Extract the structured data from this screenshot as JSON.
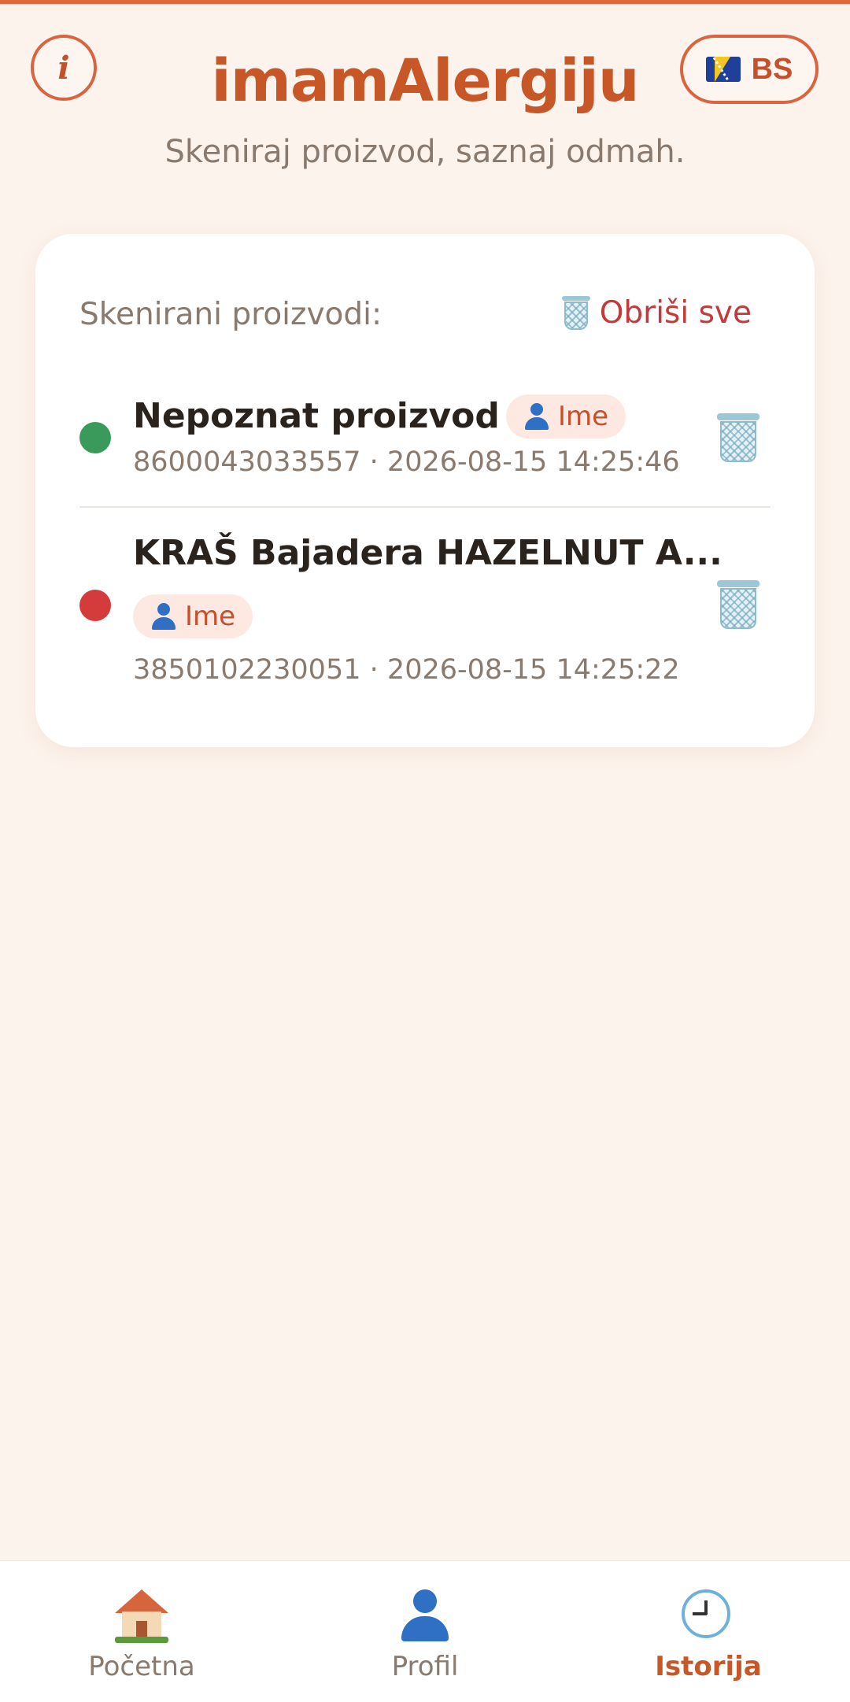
{
  "header": {
    "app_title": "imamAlergiju",
    "subtitle": "Skeniraj proizvod, saznaj odmah.",
    "info_icon_glyph": "i",
    "language_label": "BS",
    "language_flag": "bosnia-flag-icon"
  },
  "history": {
    "section_label": "Skenirani proizvodi:",
    "clear_all_label": "Obriši sve",
    "items": [
      {
        "name": "Nepoznat proizvod",
        "profile_label": "Ime",
        "barcode": "8600043033557",
        "separator": "·",
        "timestamp": "2026-08-15 14:25:46",
        "status_color": "#3a9a5b"
      },
      {
        "name": "KRAŠ Bajadera HAZELNUT A...",
        "profile_label": "Ime",
        "barcode": "3850102230051",
        "separator": "·",
        "timestamp": "2026-08-15 14:25:22",
        "status_color": "#d43c3c"
      }
    ]
  },
  "nav": {
    "items": [
      {
        "label": "Početna",
        "icon": "house-icon"
      },
      {
        "label": "Profil",
        "icon": "person-icon"
      },
      {
        "label": "Istorija",
        "icon": "clock-icon",
        "active": true
      }
    ]
  },
  "colors": {
    "accent": "#c85728",
    "background": "#fcf3ec",
    "danger": "#c23a3a"
  }
}
